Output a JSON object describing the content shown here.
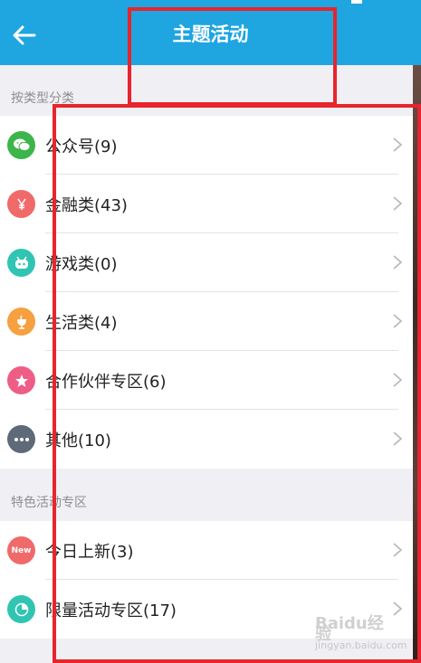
{
  "header": {
    "title": "主题活动",
    "back_icon": "back-arrow-icon"
  },
  "sections": [
    {
      "label": "按类型分类",
      "items": [
        {
          "label": "公众号(9)",
          "icon": "wechat-icon",
          "color": "#3cb54a"
        },
        {
          "label": "金融类(43)",
          "icon": "yen-icon",
          "color": "#f06a6a"
        },
        {
          "label": "游戏类(0)",
          "icon": "game-controller-icon",
          "color": "#31c4b3"
        },
        {
          "label": "生活类(4)",
          "icon": "life-cup-icon",
          "color": "#f6a03f"
        },
        {
          "label": "合作伙伴专区(6)",
          "icon": "star-icon",
          "color": "#ee5d86"
        },
        {
          "label": "其他(10)",
          "icon": "more-icon",
          "color": "#5e6a78"
        }
      ]
    },
    {
      "label": "特色活动专区",
      "items": [
        {
          "label": "今日上新(3)",
          "icon": "new-badge-icon",
          "color": "#f06a6a",
          "icon_text": "New"
        },
        {
          "label": "限量活动专区(17)",
          "icon": "limited-timer-icon",
          "color": "#31c4b3"
        }
      ]
    }
  ],
  "watermark": {
    "line1": "Baidu经验",
    "line2": "jingyan.baidu.com"
  },
  "colors": {
    "header": "#1fa5e0",
    "annotation_box": "#e8242c"
  }
}
